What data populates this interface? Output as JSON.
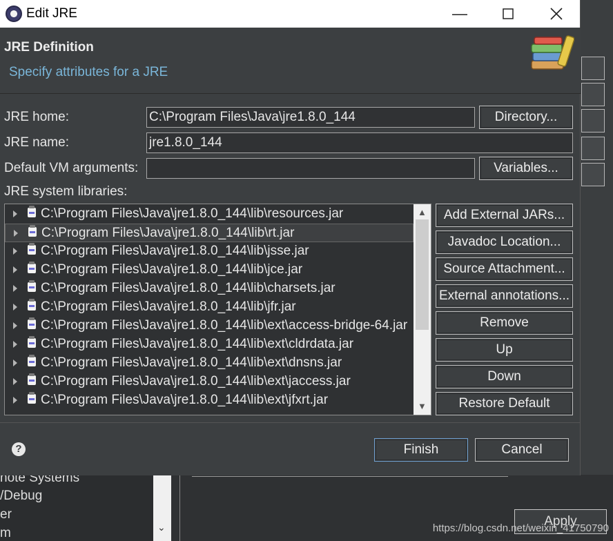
{
  "window": {
    "title": "Edit JRE"
  },
  "header": {
    "title": "JRE Definition",
    "subtitle": "Specify attributes for a JRE",
    "icon": "books-icon"
  },
  "form": {
    "jre_home_label": "JRE home:",
    "jre_home_value": "C:\\Program Files\\Java\\jre1.8.0_144",
    "directory_button": "Directory...",
    "jre_name_label": "JRE name:",
    "jre_name_value": "jre1.8.0_144",
    "vm_args_label": "Default VM arguments:",
    "vm_args_value": "",
    "variables_button": "Variables...",
    "libraries_label": "JRE system libraries:"
  },
  "libraries": [
    "C:\\Program Files\\Java\\jre1.8.0_144\\lib\\resources.jar",
    "C:\\Program Files\\Java\\jre1.8.0_144\\lib\\rt.jar",
    "C:\\Program Files\\Java\\jre1.8.0_144\\lib\\jsse.jar",
    "C:\\Program Files\\Java\\jre1.8.0_144\\lib\\jce.jar",
    "C:\\Program Files\\Java\\jre1.8.0_144\\lib\\charsets.jar",
    "C:\\Program Files\\Java\\jre1.8.0_144\\lib\\jfr.jar",
    "C:\\Program Files\\Java\\jre1.8.0_144\\lib\\ext\\access-bridge-64.jar",
    "C:\\Program Files\\Java\\jre1.8.0_144\\lib\\ext\\cldrdata.jar",
    "C:\\Program Files\\Java\\jre1.8.0_144\\lib\\ext\\dnsns.jar",
    "C:\\Program Files\\Java\\jre1.8.0_144\\lib\\ext\\jaccess.jar",
    "C:\\Program Files\\Java\\jre1.8.0_144\\lib\\ext\\jfxrt.jar"
  ],
  "selected_library": 1,
  "side_buttons": {
    "add_external": "Add External JARs...",
    "javadoc": "Javadoc Location...",
    "source": "Source Attachment...",
    "annotations": "External annotations...",
    "remove": "Remove",
    "up": "Up",
    "down": "Down",
    "restore": "Restore Default"
  },
  "footer": {
    "finish": "Finish",
    "cancel": "Cancel",
    "help": "?"
  },
  "background": {
    "tree_items": [
      "note Systems",
      "/Debug",
      "er",
      "m"
    ],
    "apply_button": "Apply",
    "watermark": "https://blog.csdn.net/weixin_41750790"
  },
  "colors": {
    "dialog_bg": "#3c3f41",
    "subtitle": "#7ab6d9",
    "default_button_border": "#6fa0d0"
  }
}
